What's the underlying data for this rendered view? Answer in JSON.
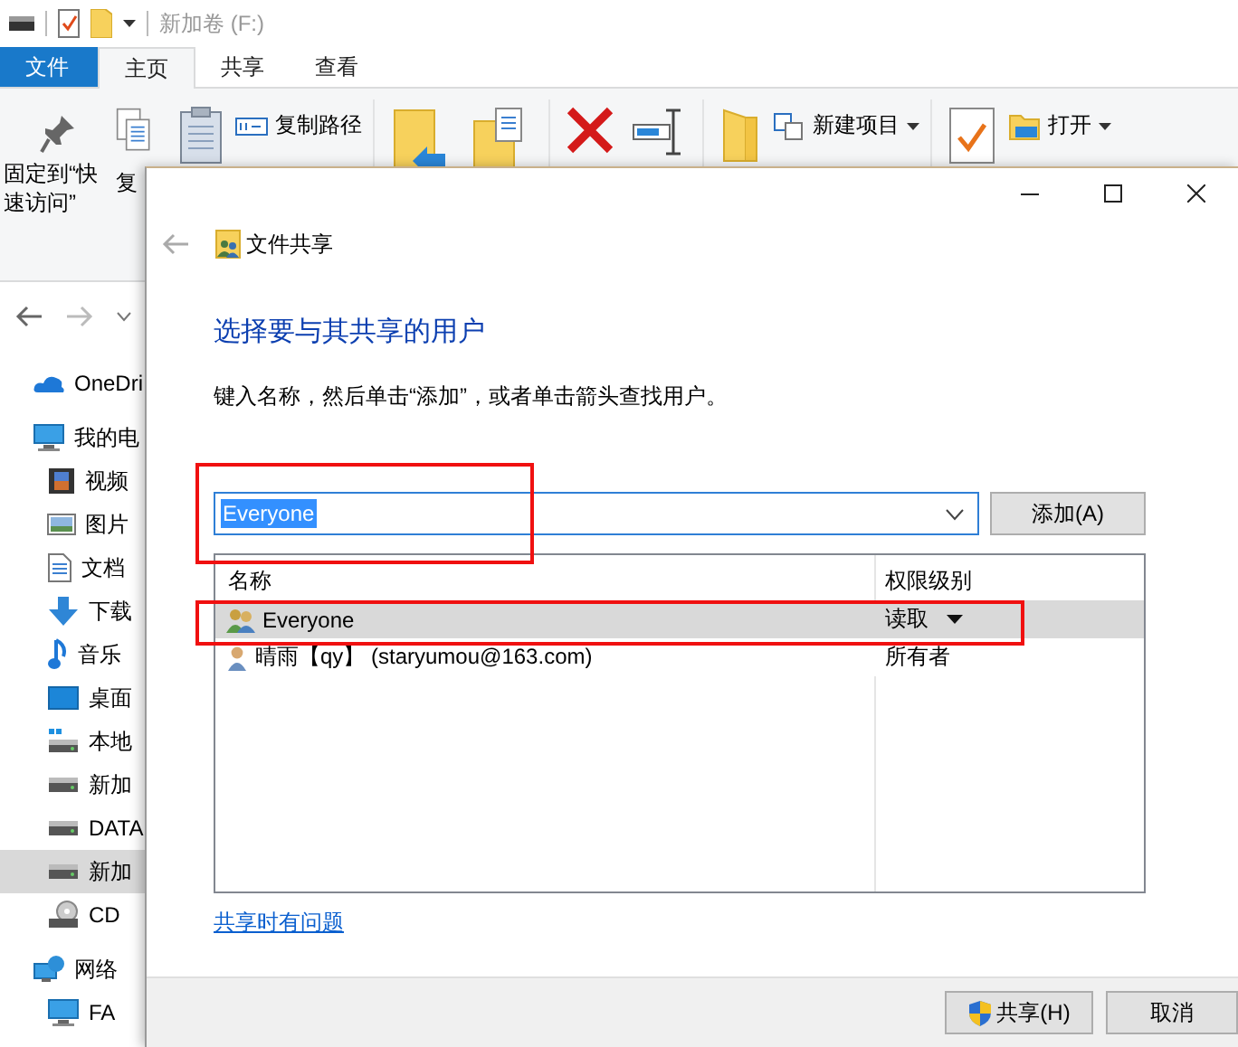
{
  "explorer": {
    "title": "新加卷 (F:)",
    "tabs": [
      {
        "label": "文件",
        "kind": "file",
        "selected": false
      },
      {
        "label": "主页",
        "kind": "tab",
        "selected": true
      },
      {
        "label": "共享",
        "kind": "tab",
        "selected": false
      },
      {
        "label": "查看",
        "kind": "tab",
        "selected": false
      }
    ],
    "ribbon": {
      "pin_label": "固定到“快速访问”",
      "copy_label": "复",
      "commands": [
        {
          "label": "复制路径"
        }
      ],
      "new_commands": [
        {
          "label": "新建项目",
          "has_menu": true
        }
      ],
      "open_command": {
        "label": "打开",
        "has_menu": true
      }
    },
    "sidebar": {
      "items": [
        {
          "label": "OneDri",
          "kind": "cloud",
          "selected": false
        },
        {
          "label": "我的电",
          "kind": "pc",
          "selected": false,
          "children": [
            {
              "label": "视频",
              "kind": "video",
              "selected": false
            },
            {
              "label": "图片",
              "kind": "image",
              "selected": false
            },
            {
              "label": "文档",
              "kind": "doc",
              "selected": false
            },
            {
              "label": "下载",
              "kind": "download",
              "selected": false
            },
            {
              "label": "音乐",
              "kind": "music",
              "selected": false
            },
            {
              "label": "桌面",
              "kind": "desktop",
              "selected": false
            },
            {
              "label": "本地",
              "kind": "windrive",
              "selected": false
            },
            {
              "label": "新加",
              "kind": "drive",
              "selected": false
            },
            {
              "label": "DATA",
              "kind": "drive",
              "selected": false
            },
            {
              "label": "新加",
              "kind": "drive",
              "selected": true
            },
            {
              "label": "CD",
              "kind": "cd",
              "selected": false
            }
          ]
        },
        {
          "label": "网络",
          "kind": "network",
          "selected": false,
          "children": [
            {
              "label": "FA",
              "kind": "pc",
              "selected": false
            }
          ]
        }
      ]
    }
  },
  "dialog": {
    "title": "文件共享",
    "heading": "选择要与其共享的用户",
    "instruction": "键入名称，然后单击“添加”，或者单击箭头查找用户。",
    "name_field": {
      "value": "Everyone",
      "selected": true
    },
    "add_button": "添加(A)",
    "table": {
      "columns": [
        "名称",
        "权限级别"
      ],
      "rows": [
        {
          "name": "Everyone",
          "kind": "group",
          "permission": "读取",
          "has_menu": true,
          "selected": true
        },
        {
          "name": "晴雨【qy】 (staryumou@163.com)",
          "kind": "user",
          "permission": "所有者",
          "has_menu": false,
          "selected": false
        }
      ]
    },
    "help_link": "共享时有问题",
    "buttons": [
      {
        "label": "共享(H)",
        "kind": "shield"
      },
      {
        "label": "取消",
        "kind": "plain"
      }
    ],
    "annotations": [
      {
        "kind": "frame"
      },
      {
        "kind": "frame"
      }
    ]
  }
}
